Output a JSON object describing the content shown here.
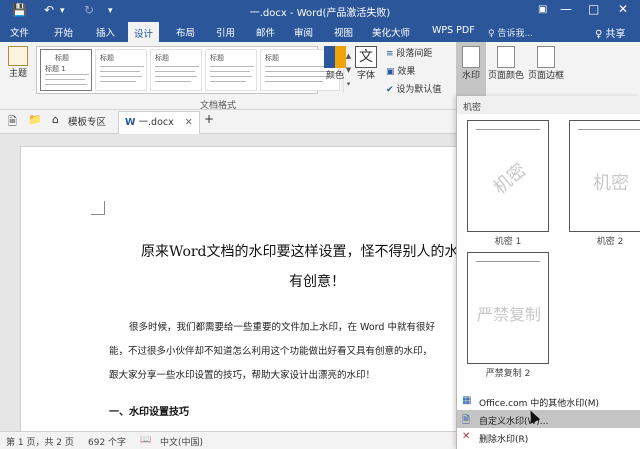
{
  "window": {
    "title": "一.docx - Word(产品激活失败)",
    "save_icon": "save-icon",
    "undo_icon": "undo-icon",
    "redo_icon": "redo-icon",
    "minimize": "—",
    "maximize": "□",
    "close": "✕"
  },
  "ribbon_tabs": {
    "file": "文件",
    "home": "开始",
    "insert": "插入",
    "design": "设计",
    "layout": "布局",
    "references": "引用",
    "mailings": "邮件",
    "review": "审阅",
    "view": "视图",
    "meituxiu": "美化大师",
    "wps_pdf": "WPS PDF",
    "tell_me": "♀ 告诉我...",
    "share": "♀ 共享"
  },
  "ribbon": {
    "theme_label": "主题",
    "style_thumbs": [
      "标题",
      "标题",
      "标题",
      "标题",
      "标题"
    ],
    "style_thumb_0_inner": "标题 1",
    "colors_label": "颜色",
    "fonts_label": "字体",
    "paragraph_spacing": "段落间距",
    "effects": "效果",
    "set_default": "设为默认值",
    "watermark_label": "水印",
    "page_color_label": "页面颜色",
    "page_border_label": "页面边框",
    "group_document_format": "文档格式",
    "font_icon_glyph": "文"
  },
  "doc_tabs": {
    "template_zone": "模板专区",
    "doc_name": "一.docx",
    "close": "✕",
    "add": "+"
  },
  "document": {
    "heading_line1": "原来Word文档的水印要这样设置，怪不得别人的水印",
    "heading_line2": "有创意！",
    "para_line1": "很多时候，我们都需要给一些重要的文件加上水印，在 Word 中就有很好",
    "para_line2": "能，不过很多小伙伴却不知道怎么利用这个功能做出好看又具有创意的水印，",
    "para_line3": "跟大家分享一些水印设置的技巧，帮助大家设计出漂亮的水印！",
    "section_heading": "一、水印设置技巧"
  },
  "status": {
    "page": "第 1 页，共 2 页",
    "words": "692 个字",
    "language": "中文(中国)"
  },
  "watermark_panel": {
    "section": "机密",
    "items": [
      {
        "caption": "机密 1",
        "text": "机密"
      },
      {
        "caption": "机密 2",
        "text": "机密"
      },
      {
        "caption": "严禁复制 2",
        "text": "严禁复制"
      }
    ],
    "menu_more": "Office.com 中的其他水印(M)",
    "menu_custom": "自定义水印(W)...",
    "menu_remove": "删除水印(R)"
  }
}
